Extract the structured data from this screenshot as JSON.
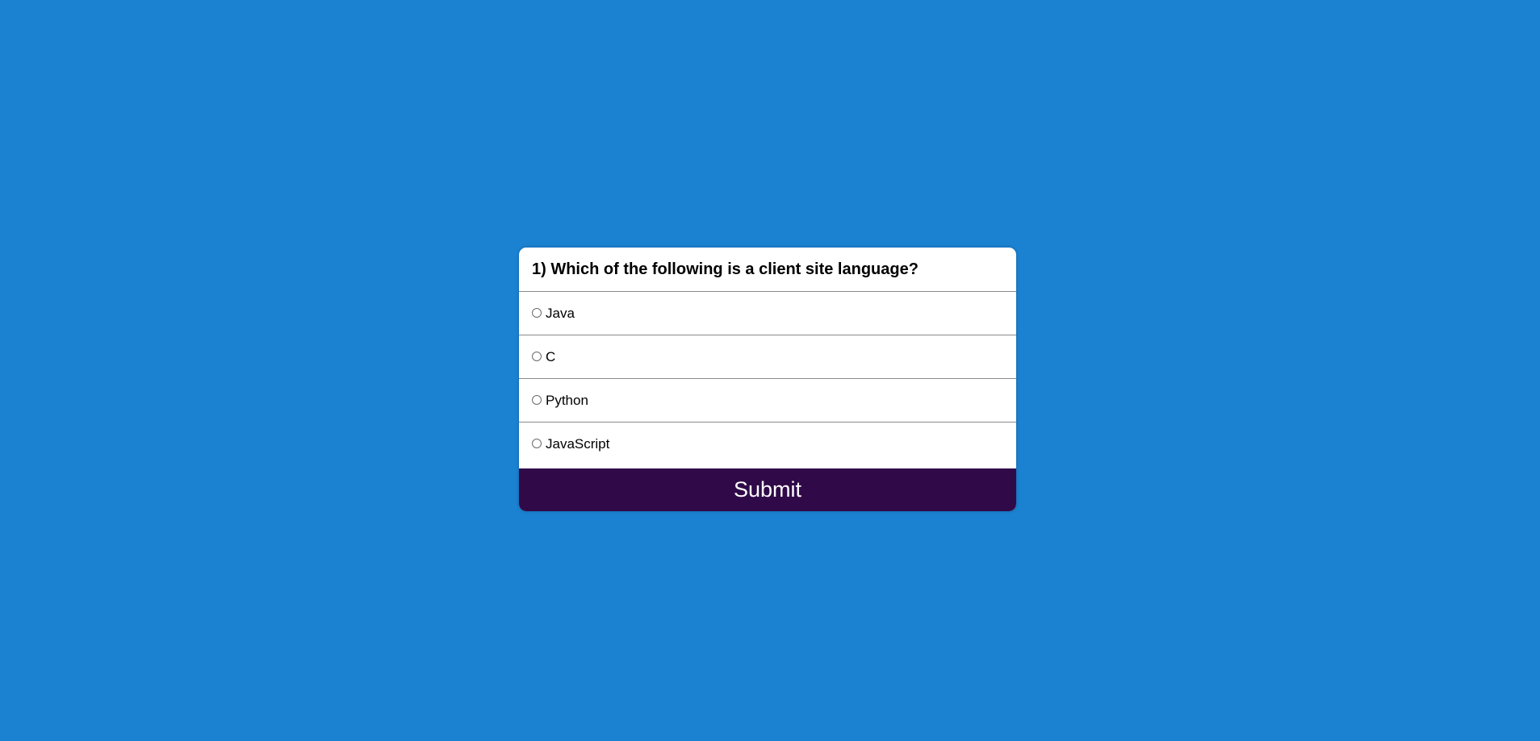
{
  "colors": {
    "background": "#1b82d2",
    "card": "#ffffff",
    "submit_button": "#300a48",
    "submit_text": "#ffffff"
  },
  "quiz": {
    "question": "1) Which of the following is a client site language?",
    "options": [
      {
        "label": "Java"
      },
      {
        "label": "C"
      },
      {
        "label": "Python"
      },
      {
        "label": "JavaScript"
      }
    ],
    "submit_label": "Submit"
  }
}
